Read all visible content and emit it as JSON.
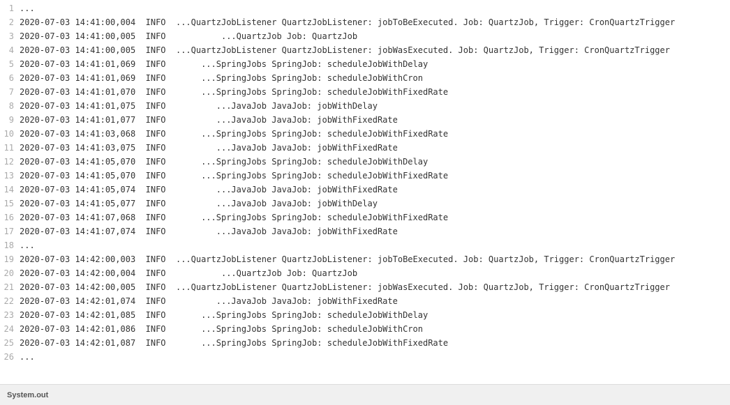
{
  "footer": {
    "label": "System.out"
  },
  "lines": [
    {
      "num": 1,
      "text": "..."
    },
    {
      "num": 2,
      "text": "2020-07-03 14:41:00,004  INFO  ...QuartzJobListener QuartzJobListener: jobToBeExecuted. Job: QuartzJob, Trigger: CronQuartzTrigger"
    },
    {
      "num": 3,
      "text": "2020-07-03 14:41:00,005  INFO           ...QuartzJob Job: QuartzJob"
    },
    {
      "num": 4,
      "text": "2020-07-03 14:41:00,005  INFO  ...QuartzJobListener QuartzJobListener: jobWasExecuted. Job: QuartzJob, Trigger: CronQuartzTrigger"
    },
    {
      "num": 5,
      "text": "2020-07-03 14:41:01,069  INFO       ...SpringJobs SpringJob: scheduleJobWithDelay"
    },
    {
      "num": 6,
      "text": "2020-07-03 14:41:01,069  INFO       ...SpringJobs SpringJob: scheduleJobWithCron"
    },
    {
      "num": 7,
      "text": "2020-07-03 14:41:01,070  INFO       ...SpringJobs SpringJob: scheduleJobWithFixedRate"
    },
    {
      "num": 8,
      "text": "2020-07-03 14:41:01,075  INFO          ...JavaJob JavaJob: jobWithDelay"
    },
    {
      "num": 9,
      "text": "2020-07-03 14:41:01,077  INFO          ...JavaJob JavaJob: jobWithFixedRate"
    },
    {
      "num": 10,
      "text": "2020-07-03 14:41:03,068  INFO       ...SpringJobs SpringJob: scheduleJobWithFixedRate"
    },
    {
      "num": 11,
      "text": "2020-07-03 14:41:03,075  INFO          ...JavaJob JavaJob: jobWithFixedRate"
    },
    {
      "num": 12,
      "text": "2020-07-03 14:41:05,070  INFO       ...SpringJobs SpringJob: scheduleJobWithDelay"
    },
    {
      "num": 13,
      "text": "2020-07-03 14:41:05,070  INFO       ...SpringJobs SpringJob: scheduleJobWithFixedRate"
    },
    {
      "num": 14,
      "text": "2020-07-03 14:41:05,074  INFO          ...JavaJob JavaJob: jobWithFixedRate"
    },
    {
      "num": 15,
      "text": "2020-07-03 14:41:05,077  INFO          ...JavaJob JavaJob: jobWithDelay"
    },
    {
      "num": 16,
      "text": "2020-07-03 14:41:07,068  INFO       ...SpringJobs SpringJob: scheduleJobWithFixedRate"
    },
    {
      "num": 17,
      "text": "2020-07-03 14:41:07,074  INFO          ...JavaJob JavaJob: jobWithFixedRate"
    },
    {
      "num": 18,
      "text": "..."
    },
    {
      "num": 19,
      "text": "2020-07-03 14:42:00,003  INFO  ...QuartzJobListener QuartzJobListener: jobToBeExecuted. Job: QuartzJob, Trigger: CronQuartzTrigger"
    },
    {
      "num": 20,
      "text": "2020-07-03 14:42:00,004  INFO           ...QuartzJob Job: QuartzJob"
    },
    {
      "num": 21,
      "text": "2020-07-03 14:42:00,005  INFO  ...QuartzJobListener QuartzJobListener: jobWasExecuted. Job: QuartzJob, Trigger: CronQuartzTrigger"
    },
    {
      "num": 22,
      "text": "2020-07-03 14:42:01,074  INFO          ...JavaJob JavaJob: jobWithFixedRate"
    },
    {
      "num": 23,
      "text": "2020-07-03 14:42:01,085  INFO       ...SpringJobs SpringJob: scheduleJobWithDelay"
    },
    {
      "num": 24,
      "text": "2020-07-03 14:42:01,086  INFO       ...SpringJobs SpringJob: scheduleJobWithCron"
    },
    {
      "num": 25,
      "text": "2020-07-03 14:42:01,087  INFO       ...SpringJobs SpringJob: scheduleJobWithFixedRate"
    },
    {
      "num": 26,
      "text": "..."
    }
  ]
}
